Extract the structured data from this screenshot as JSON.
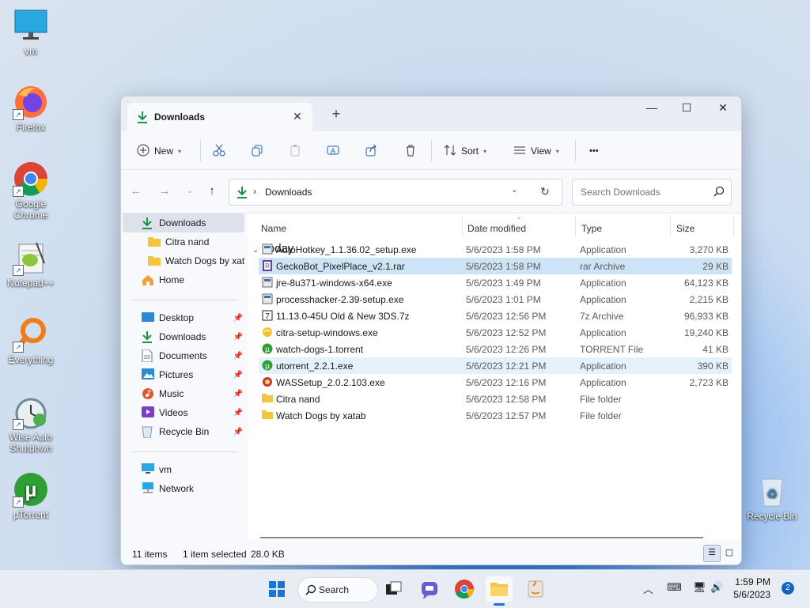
{
  "desktop": {
    "icons": [
      "vm",
      "Firefox",
      "Google Chrome",
      "Notepad++",
      "Everything",
      "Wise Auto Shutdown",
      "µTorrent",
      "Recycle Bin"
    ]
  },
  "window": {
    "tab_title": "Downloads",
    "controls": {
      "minimize": "—",
      "maximize": "☐",
      "close": "✕"
    },
    "toolbar": {
      "new": "New",
      "sort": "Sort",
      "view": "View",
      "more": "•••"
    },
    "address": {
      "path": "Downloads",
      "search_placeholder": "Search Downloads"
    },
    "sidebar": {
      "quick": [
        "Downloads",
        "Citra nand",
        "Watch Dogs by xatab",
        "Home"
      ],
      "pinned": [
        "Desktop",
        "Downloads",
        "Documents",
        "Pictures",
        "Music",
        "Videos",
        "Recycle Bin"
      ],
      "other": [
        "vm",
        "Network"
      ]
    },
    "columns": {
      "name": "Name",
      "date": "Date modified",
      "type": "Type",
      "size": "Size"
    },
    "group": "Today",
    "files": [
      {
        "name": "AutoHotkey_1.1.36.02_setup.exe",
        "date": "5/6/2023 1:58 PM",
        "type": "Application",
        "size": "3,270 KB"
      },
      {
        "name": "GeckoBot_PixelPlace_v2.1.rar",
        "date": "5/6/2023 1:58 PM",
        "type": "rar Archive",
        "size": "29 KB"
      },
      {
        "name": "jre-8u371-windows-x64.exe",
        "date": "5/6/2023 1:49 PM",
        "type": "Application",
        "size": "64,123 KB"
      },
      {
        "name": "processhacker-2.39-setup.exe",
        "date": "5/6/2023 1:01 PM",
        "type": "Application",
        "size": "2,215 KB"
      },
      {
        "name": "11.13.0-45U Old & New 3DS.7z",
        "date": "5/6/2023 12:56 PM",
        "type": "7z Archive",
        "size": "96,933 KB"
      },
      {
        "name": "citra-setup-windows.exe",
        "date": "5/6/2023 12:52 PM",
        "type": "Application",
        "size": "19,240 KB"
      },
      {
        "name": "watch-dogs-1.torrent",
        "date": "5/6/2023 12:26 PM",
        "type": "TORRENT File",
        "size": "41 KB"
      },
      {
        "name": "utorrent_2.2.1.exe",
        "date": "5/6/2023 12:21 PM",
        "type": "Application",
        "size": "390 KB"
      },
      {
        "name": "WASSetup_2.0.2.103.exe",
        "date": "5/6/2023 12:16 PM",
        "type": "Application",
        "size": "2,723 KB"
      },
      {
        "name": "Citra nand",
        "date": "5/6/2023 12:58 PM",
        "type": "File folder",
        "size": ""
      },
      {
        "name": "Watch Dogs by xatab",
        "date": "5/6/2023 12:57 PM",
        "type": "File folder",
        "size": ""
      }
    ],
    "status": {
      "count": "11 items",
      "selected": "1 item selected",
      "size": "28.0 KB"
    }
  },
  "taskbar": {
    "search": "Search",
    "time": "1:59 PM",
    "date": "5/6/2023",
    "notifications": "2"
  }
}
